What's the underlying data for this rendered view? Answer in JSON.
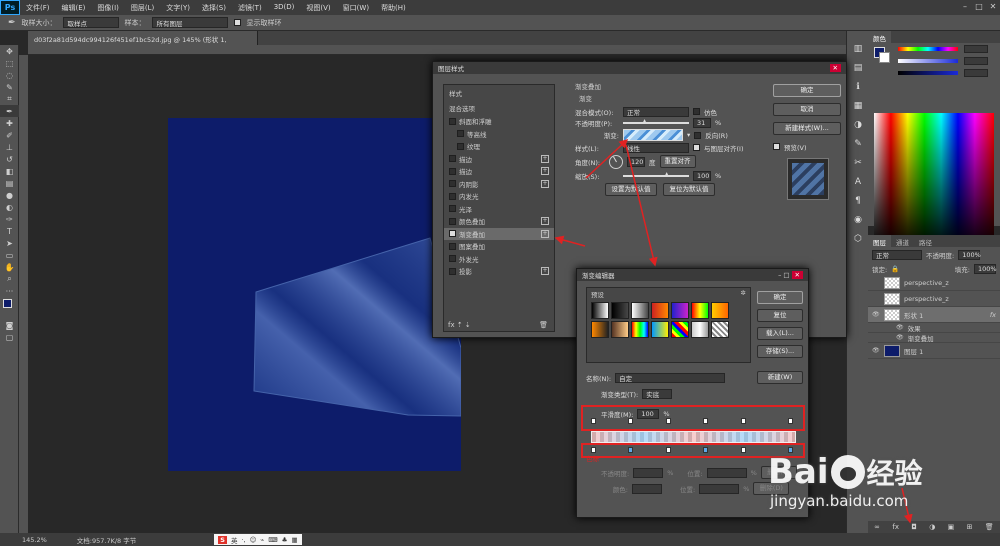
{
  "app": {
    "logo": "Ps"
  },
  "menu": [
    "文件(F)",
    "编辑(E)",
    "图像(I)",
    "图层(L)",
    "文字(Y)",
    "选择(S)",
    "滤镜(T)",
    "3D(D)",
    "视图(V)",
    "窗口(W)",
    "帮助(H)"
  ],
  "options": {
    "size_label": "取样大小：",
    "size_value": "取样点",
    "sample_label": "样本：",
    "sample_value": "所有图层",
    "ring_label": "显示取样环"
  },
  "document": {
    "tab": "d03f2a81d594dc994126f451ef1bc52d.jpg @ 145% (形状 1, RGB/8#) *",
    "zoom": "145.2%",
    "doc_info": "文档:957.7K/8 字节"
  },
  "layer_style": {
    "title": "图层样式",
    "list_header": "样式",
    "blend_options": "混合选项",
    "items": [
      "斜面和浮雕",
      "等高线",
      "纹理",
      "描边",
      "描边",
      "内阴影",
      "内发光",
      "光泽",
      "颜色叠加",
      "渐变叠加",
      "图案叠加",
      "外发光",
      "投影"
    ],
    "section": "渐变叠加",
    "sub": "渐变",
    "blend_mode_label": "混合模式(O):",
    "blend_mode": "正常",
    "dither": "仿色",
    "opacity_label": "不透明度(P):",
    "opacity": "31",
    "gradient_label": "渐变:",
    "reverse": "反向(R)",
    "style_label": "样式(L):",
    "style": "线性",
    "align": "与图层对齐(I)",
    "angle_label": "角度(N):",
    "angle": "120",
    "angle_unit": "度",
    "reset_align": "重置对齐",
    "scale_label": "缩放(S):",
    "scale": "100",
    "set_default": "设置为默认值",
    "reset_default": "复位为默认值",
    "ok": "确定",
    "cancel": "取消",
    "new_style": "新建样式(W)...",
    "preview": "预览(V)"
  },
  "gradient_editor": {
    "title": "渐变编辑器",
    "presets": "预设",
    "ok": "确定",
    "reset": "复位",
    "load": "载入(L)...",
    "save": "存储(S)...",
    "name_label": "名称(N):",
    "name": "自定",
    "new": "新建(W)",
    "type_label": "渐变类型(T):",
    "type": "实底",
    "smooth_label": "平滑度(M):",
    "smooth": "100",
    "percent": "%",
    "stops": "色标",
    "opacity_label": "不透明度:",
    "location_label": "位置:",
    "delete": "删除(D)",
    "color_label": "颜色:"
  },
  "color_panel": {
    "tab": "颜色"
  },
  "layers_panel": {
    "tabs": [
      "图层",
      "通道",
      "路径"
    ],
    "mode": "正常",
    "opacity_label": "不透明度:",
    "opacity": "100%",
    "lock_label": "锁定:",
    "fill_label": "填充:",
    "fill": "100%",
    "layers": [
      {
        "name": "perspective_z",
        "sub": false
      },
      {
        "name": "perspective_z",
        "sub": false
      },
      {
        "name": "形状 1",
        "sub": false
      },
      {
        "name": "效果",
        "sub": true
      },
      {
        "name": "渐变叠加",
        "sub": true
      },
      {
        "name": "图层 1",
        "sub": false
      }
    ],
    "fx": "fx"
  },
  "watermark": {
    "brand": "Bai",
    "brand2": "经验",
    "url": "jingyan.baidu.com"
  },
  "taskbar": {
    "ime": "英"
  }
}
